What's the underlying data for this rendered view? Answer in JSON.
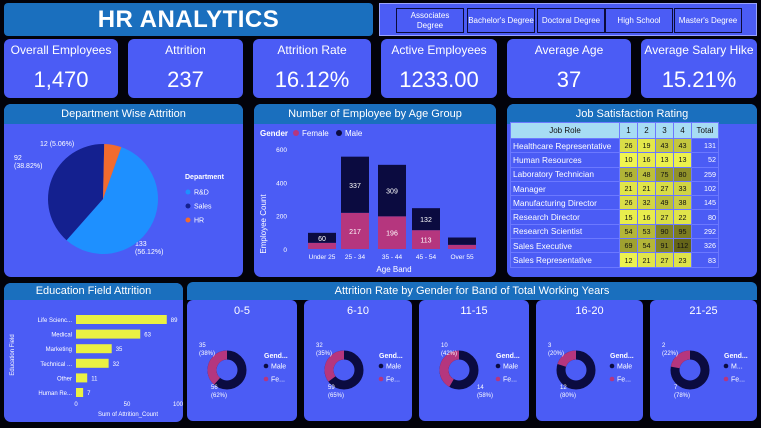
{
  "title": "HR ANALYTICS",
  "slicer": [
    "Associates Degree",
    "Bachelor's Degree",
    "Doctoral Degree",
    "High School",
    "Master's Degree"
  ],
  "kpis": [
    {
      "label": "Overall Employees",
      "value": "1,470"
    },
    {
      "label": "Attrition",
      "value": "237"
    },
    {
      "label": "Attrition Rate",
      "value": "16.12%"
    },
    {
      "label": "Active Employees",
      "value": "1233.00"
    },
    {
      "label": "Average Age",
      "value": "37"
    },
    {
      "label": "Average Salary Hike",
      "value": "15.21%"
    }
  ],
  "dept": {
    "title": "Department Wise Attrition",
    "legend_title": "Department",
    "slices": [
      {
        "name": "R&D",
        "value": 133,
        "label": "133\n(56.12%)",
        "color": "#1e90ff"
      },
      {
        "name": "Sales",
        "value": 92,
        "label": "92\n(38.82%)",
        "color": "#14208f"
      },
      {
        "name": "HR",
        "value": 12,
        "label": "12 (5.06%)",
        "color": "#f26b2e"
      }
    ]
  },
  "age": {
    "title": "Number of Employee by Age Group",
    "legend_title": "Gender",
    "ylabel": "Employee Count",
    "xlabel": "Age Band",
    "yticks": [
      "0",
      "200",
      "400",
      "600"
    ]
  },
  "chart_data": [
    {
      "type": "bar",
      "title": "Number of Employee by Age Group",
      "xlabel": "Age Band",
      "ylabel": "Employee Count",
      "ylim": [
        0,
        600
      ],
      "categories": [
        "Under 25",
        "25 - 34",
        "35 - 44",
        "45 - 54",
        "Over 55"
      ],
      "series": [
        {
          "name": "Female",
          "color": "#b5367e",
          "values": [
            37,
            217,
            196,
            113,
            25
          ]
        },
        {
          "name": "Male",
          "color": "#0b0b40",
          "values": [
            60,
            337,
            309,
            132,
            44
          ]
        }
      ]
    },
    {
      "type": "bar",
      "title": "Education Field Attrition",
      "xlabel": "Sum of Attrition_Count",
      "ylabel": "Education Field",
      "xlim": [
        0,
        100
      ],
      "categories": [
        "Life Scienc...",
        "Medical",
        "Marketing",
        "Technical ...",
        "Other",
        "Human Re..."
      ],
      "values": [
        89,
        63,
        35,
        32,
        11,
        7
      ],
      "xticks": [
        "0",
        "50",
        "100"
      ]
    },
    {
      "type": "pie",
      "title": "Department Wise Attrition",
      "categories": [
        "R&D",
        "Sales",
        "HR"
      ],
      "values": [
        133,
        92,
        12
      ]
    }
  ],
  "age_seg_labels": {
    "female": [
      "",
      "217",
      "196",
      "113",
      ""
    ],
    "male": [
      "60",
      "337",
      "309",
      "132",
      ""
    ]
  },
  "jobsat": {
    "title": "Job Satisfaction Rating",
    "headers": [
      "Job Role",
      "1",
      "2",
      "3",
      "4",
      "Total"
    ],
    "rows": [
      [
        "Healthcare Representative",
        "26",
        "19",
        "43",
        "43",
        "131"
      ],
      [
        "Human Resources",
        "10",
        "16",
        "13",
        "13",
        "52"
      ],
      [
        "Laboratory Technician",
        "56",
        "48",
        "75",
        "80",
        "259"
      ],
      [
        "Manager",
        "21",
        "21",
        "27",
        "33",
        "102"
      ],
      [
        "Manufacturing Director",
        "26",
        "32",
        "49",
        "38",
        "145"
      ],
      [
        "Research Director",
        "15",
        "16",
        "27",
        "22",
        "80"
      ],
      [
        "Research Scientist",
        "54",
        "53",
        "90",
        "95",
        "292"
      ],
      [
        "Sales Executive",
        "69",
        "54",
        "91",
        "112",
        "326"
      ],
      [
        "Sales Representative",
        "12",
        "21",
        "27",
        "23",
        "83"
      ]
    ]
  },
  "edu": {
    "title": "Education Field Attrition",
    "ylabel": "Education Field",
    "xlabel": "Sum of Attrition_Count"
  },
  "gender_title": "Attrition Rate by Gender for Band of Total Working Years",
  "donuts": [
    {
      "band": "0-5",
      "female": "35\n(38%)",
      "male": "56\n(62%)",
      "fv": 35,
      "mv": 56
    },
    {
      "band": "6-10",
      "female": "32\n(35%)",
      "male": "59\n(65%)",
      "fv": 32,
      "mv": 59
    },
    {
      "band": "11-15",
      "female": "10\n(42%)",
      "male": "14\n(58%)",
      "fv": 10,
      "mv": 14
    },
    {
      "band": "16-20",
      "female": "3\n(20%)",
      "male": "12\n(80%)",
      "fv": 3,
      "mv": 12
    },
    {
      "band": "21-25",
      "female": "2\n(22%)",
      "male": "7\n(78%)",
      "fv": 2,
      "mv": 7
    }
  ],
  "donut_legend": {
    "title": "Gend...",
    "male": "Male",
    "female": "Fe..."
  },
  "donut_legend_short": {
    "male": "M..."
  },
  "colors": {
    "panel": "#4b5cf5",
    "header": "#1a6fbe",
    "male": "#0b0b40",
    "female": "#b5367e"
  }
}
